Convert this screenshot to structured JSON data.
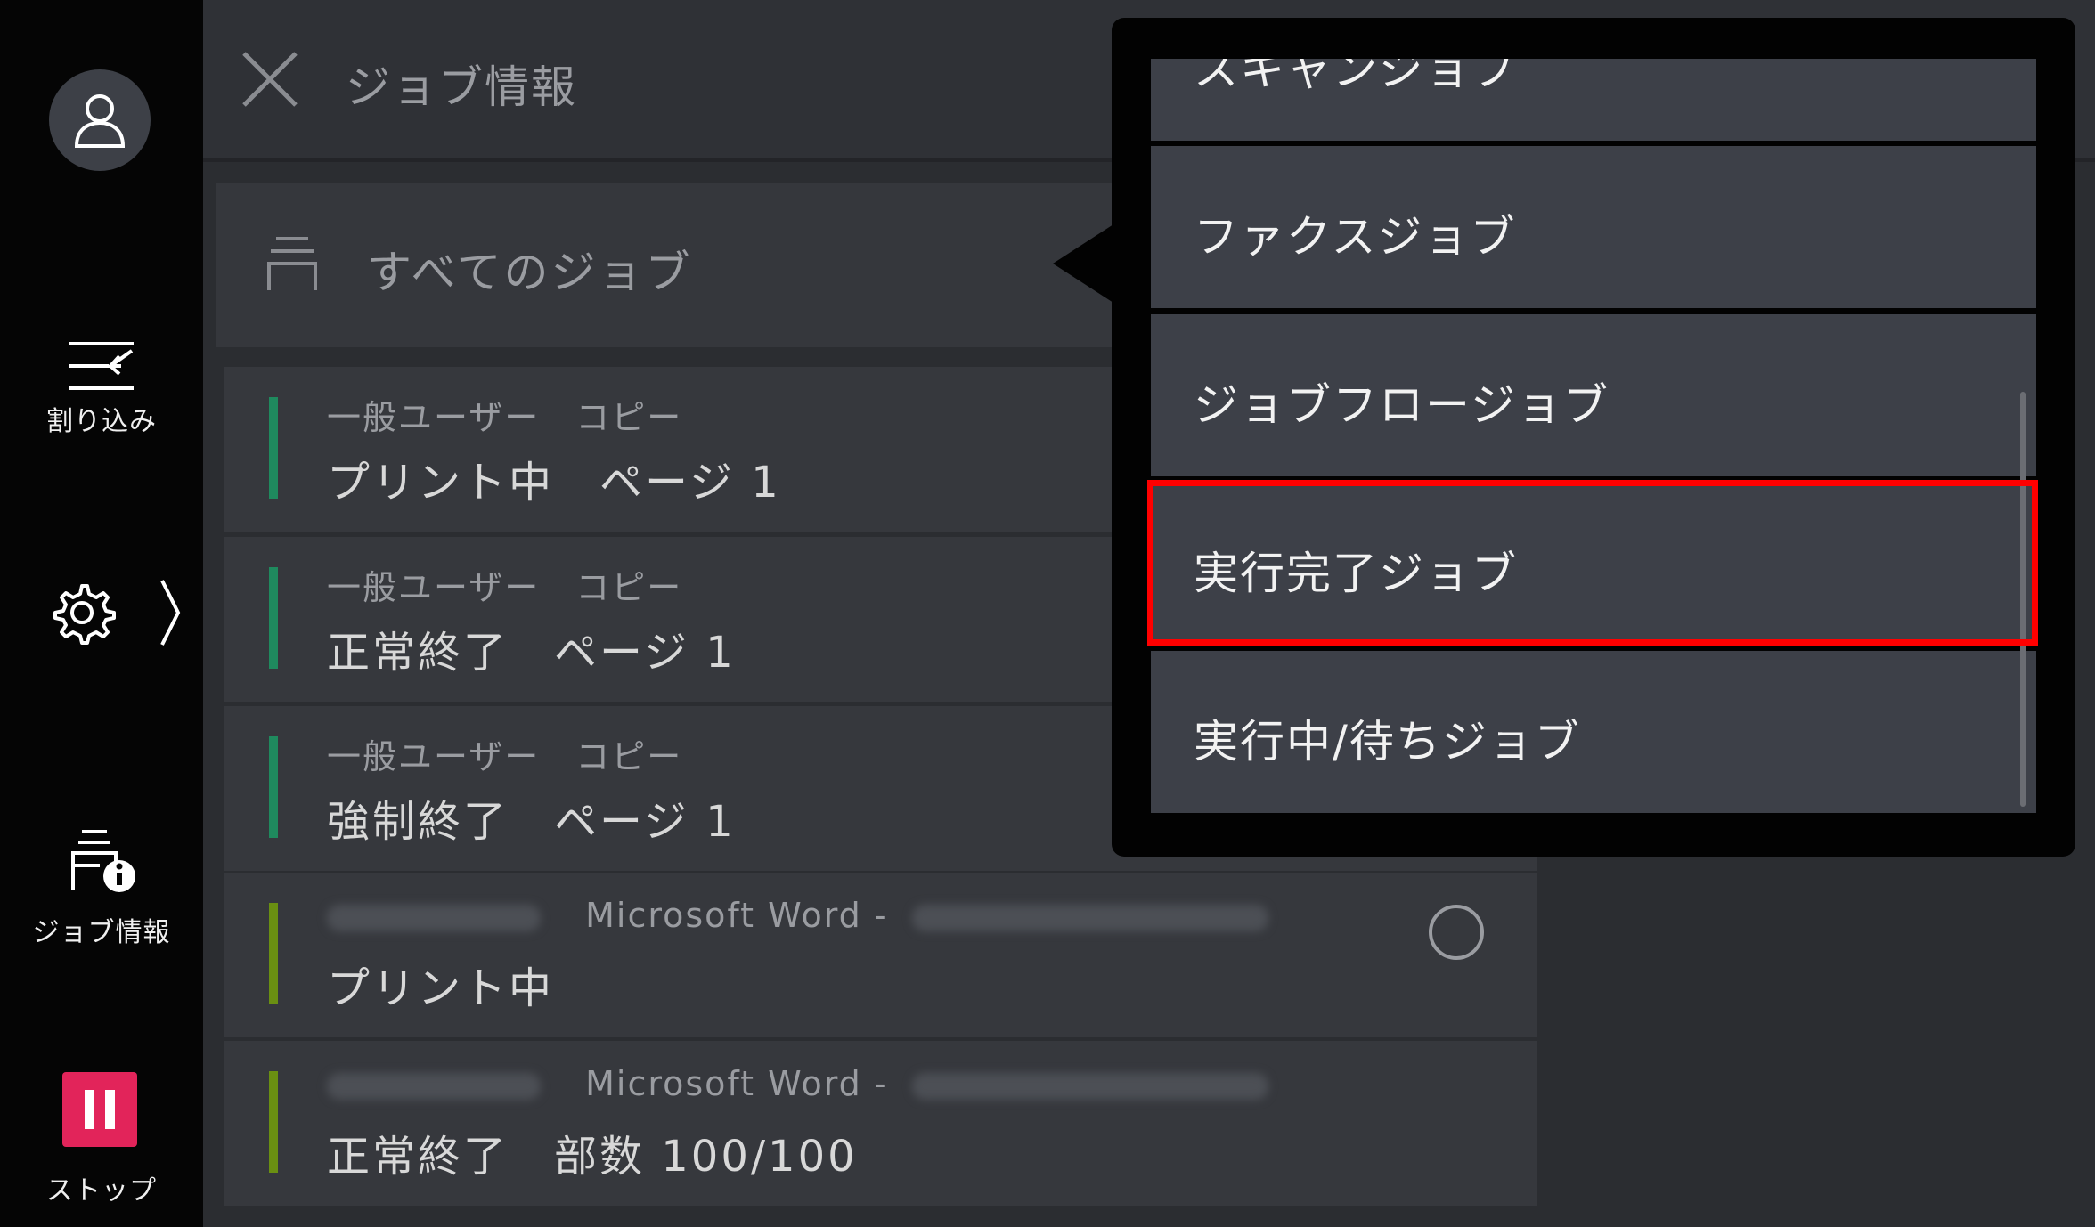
{
  "rail": {
    "interrupt_label": "割り込み",
    "job_info_label": "ジョブ情報",
    "stop_label": "ストップ"
  },
  "header": {
    "title": "ジョブ情報"
  },
  "filter": {
    "label": "すべてのジョブ"
  },
  "jobs": [
    {
      "line1": "一般ユーザー　コピー",
      "line2": "プリント中　ページ 1",
      "bar_color": "#1f8a5e"
    },
    {
      "line1": "一般ユーザー　コピー",
      "line2": "正常終了　ページ 1",
      "bar_color": "#1f8a5e"
    },
    {
      "line1": "一般ユーザー　コピー",
      "line2": "強制終了　ページ 1",
      "bar_color": "#1f8a5e"
    },
    {
      "app": "Microsoft Word -",
      "line2": "プリント中",
      "bar_color": "#6a8f12"
    },
    {
      "app": "Microsoft Word -",
      "line2": "正常終了　部数 100/100",
      "bar_color": "#6a8f12"
    }
  ],
  "dropdown": {
    "options": [
      "スキャンジョブ",
      "ファクスジョブ",
      "ジョブフロージョブ",
      "実行完了ジョブ",
      "実行中/待ちジョブ"
    ],
    "highlighted_option": "実行完了ジョブ",
    "highlight_color": "#ff0000"
  }
}
